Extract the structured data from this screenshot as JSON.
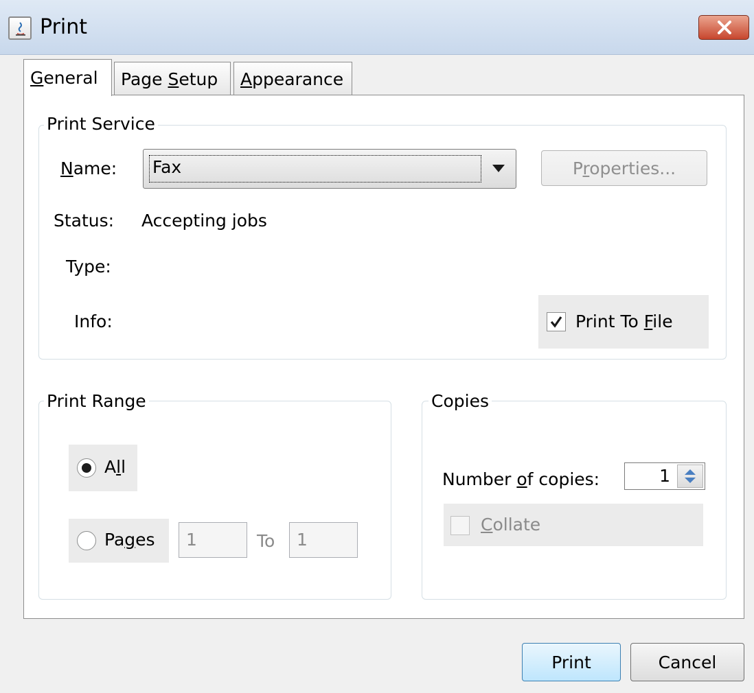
{
  "window": {
    "title": "Print"
  },
  "tabs": [
    {
      "pre": "",
      "mn": "G",
      "post": "eneral"
    },
    {
      "pre": "Page ",
      "mn": "S",
      "post": "etup"
    },
    {
      "pre": "",
      "mn": "A",
      "post": "ppearance"
    }
  ],
  "print_service": {
    "title": "Print Service",
    "name_label": {
      "pre": "",
      "mn": "N",
      "post": "ame:"
    },
    "name_value": "Fax",
    "properties_button": {
      "pre": "P",
      "mn": "r",
      "post": "operties..."
    },
    "status_label": "Status:",
    "status_value": "Accepting jobs",
    "type_label": "Type:",
    "info_label": "Info:",
    "print_to_file": {
      "pre": "Print To ",
      "mn": "F",
      "post": "ile",
      "checked": true
    }
  },
  "print_range": {
    "title": "Print Range",
    "all": {
      "pre": "A",
      "mn": "l",
      "post": "l",
      "selected": true
    },
    "pages": {
      "pre": "Pa",
      "mn": "g",
      "post": "es",
      "selected": false
    },
    "from_value": "1",
    "to_label": "To",
    "to_value": "1"
  },
  "copies": {
    "title": "Copies",
    "number_label": {
      "pre": "Number ",
      "mn": "o",
      "post": "f copies:"
    },
    "number_value": "1",
    "collate": {
      "pre": "",
      "mn": "C",
      "post": "ollate",
      "checked": false
    }
  },
  "buttons": {
    "print": "Print",
    "cancel": "Cancel"
  },
  "colors": {
    "default_button_border": "#3c7fb1",
    "close_button": "#c7462e"
  }
}
